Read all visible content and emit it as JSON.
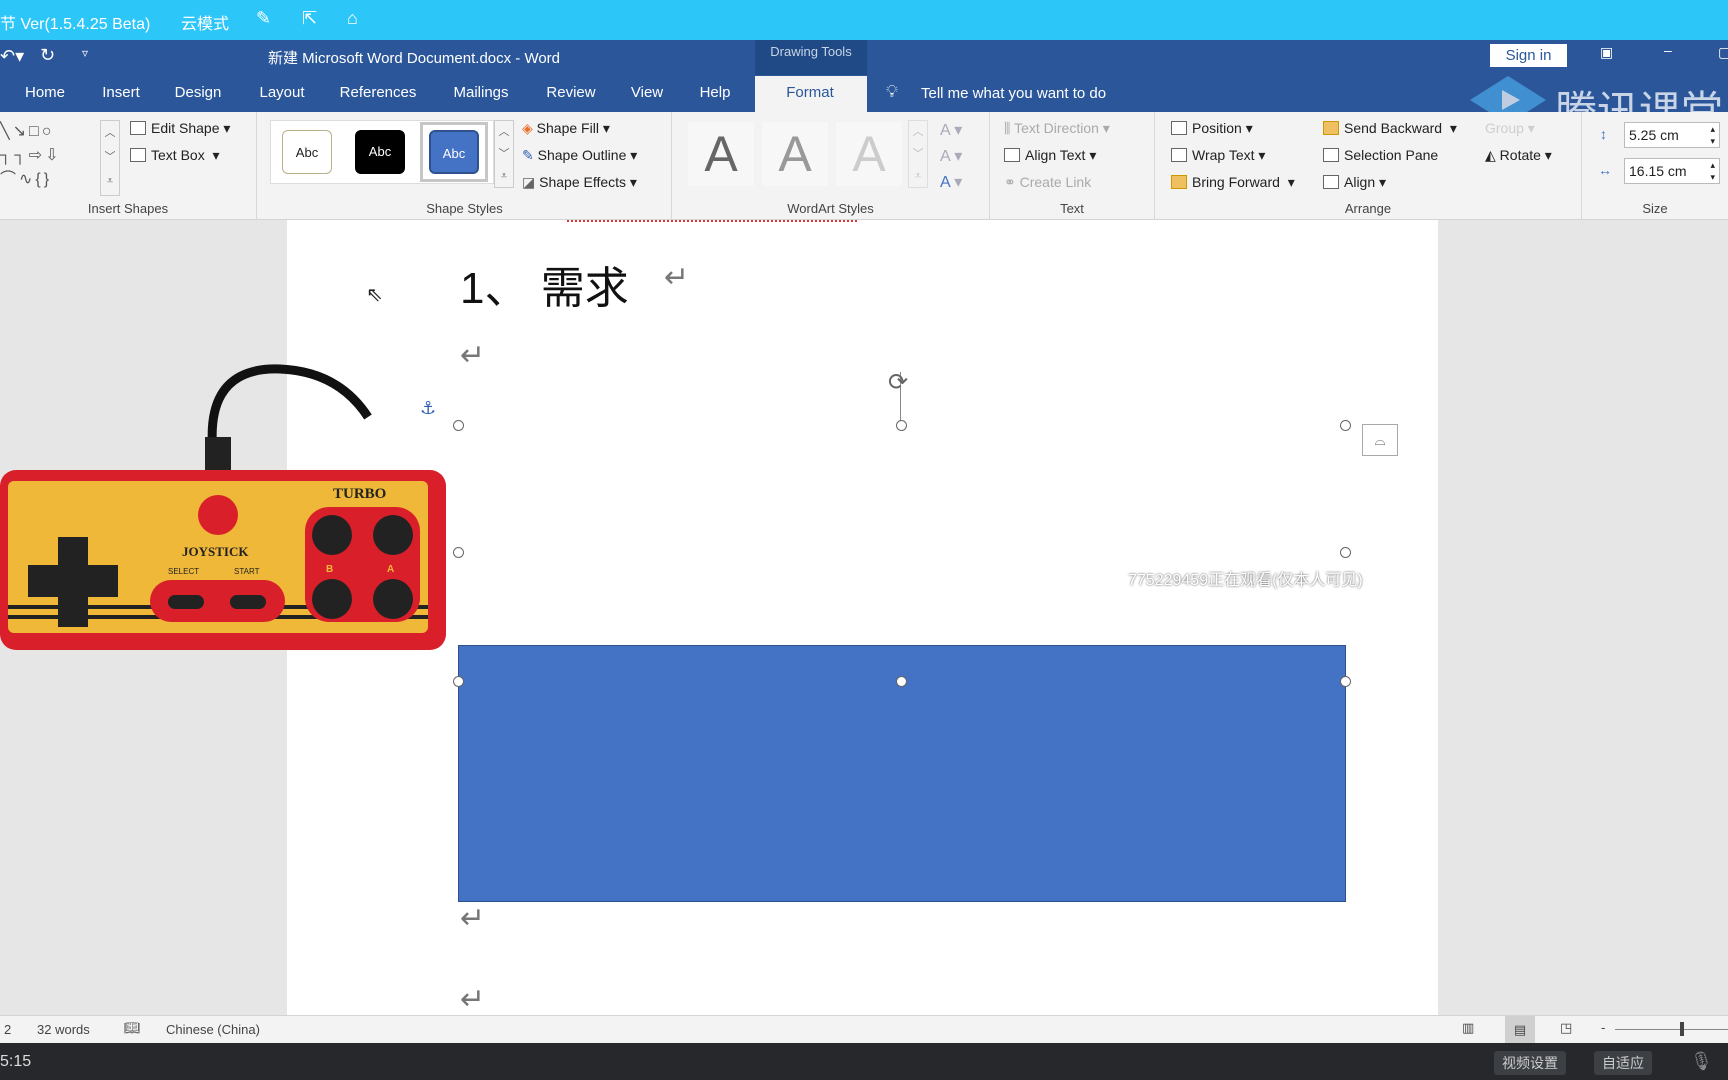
{
  "player_bar": {
    "title": "节 Ver(1.5.4.25 Beta)",
    "mode": "云模式"
  },
  "word": {
    "title": "新建 Microsoft Word Document.docx  -  Word",
    "context_tab": "Drawing Tools",
    "sign_in": "Sign in",
    "tabs": [
      "Home",
      "Insert",
      "Design",
      "Layout",
      "References",
      "Mailings",
      "Review",
      "View",
      "Help",
      "Format"
    ],
    "active_tab": "Format",
    "tell_me": "Tell me what you want to do",
    "watermark": "腾讯课堂"
  },
  "ribbon": {
    "insert_shapes": {
      "label": "Insert Shapes",
      "edit_shape": "Edit Shape",
      "text_box": "Text Box"
    },
    "shape_styles": {
      "label": "Shape Styles",
      "style_sample": "Abc",
      "fill": "Shape Fill",
      "outline": "Shape Outline",
      "effects": "Shape Effects"
    },
    "wordart": {
      "label": "WordArt Styles",
      "sample": "A"
    },
    "text": {
      "label": "Text",
      "direction": "Text Direction",
      "align": "Align Text",
      "link": "Create Link"
    },
    "arrange": {
      "label": "Arrange",
      "position": "Position",
      "wrap": "Wrap Text",
      "forward": "Bring Forward",
      "backward": "Send Backward",
      "pane": "Selection Pane",
      "align": "Align",
      "group": "Group",
      "rotate": "Rotate"
    },
    "size": {
      "label": "Size",
      "height": "5.25 cm",
      "width": "16.15 cm"
    }
  },
  "document": {
    "heading": "1、  需求",
    "return_mark": "↵",
    "viewer_notice": "775229459正在观看(仅本人可见)",
    "joystick": {
      "brand": "TURBO",
      "name": "JOYSTICK",
      "select": "SELECT",
      "start": "START",
      "b": "B",
      "a": "A"
    },
    "shape_fill": "#4472c4"
  },
  "status": {
    "page": "2",
    "words": "32 words",
    "language": "Chinese (China)"
  },
  "bottom": {
    "time": "5:15",
    "video_settings": "视频设置",
    "adaptive": "自适应"
  }
}
